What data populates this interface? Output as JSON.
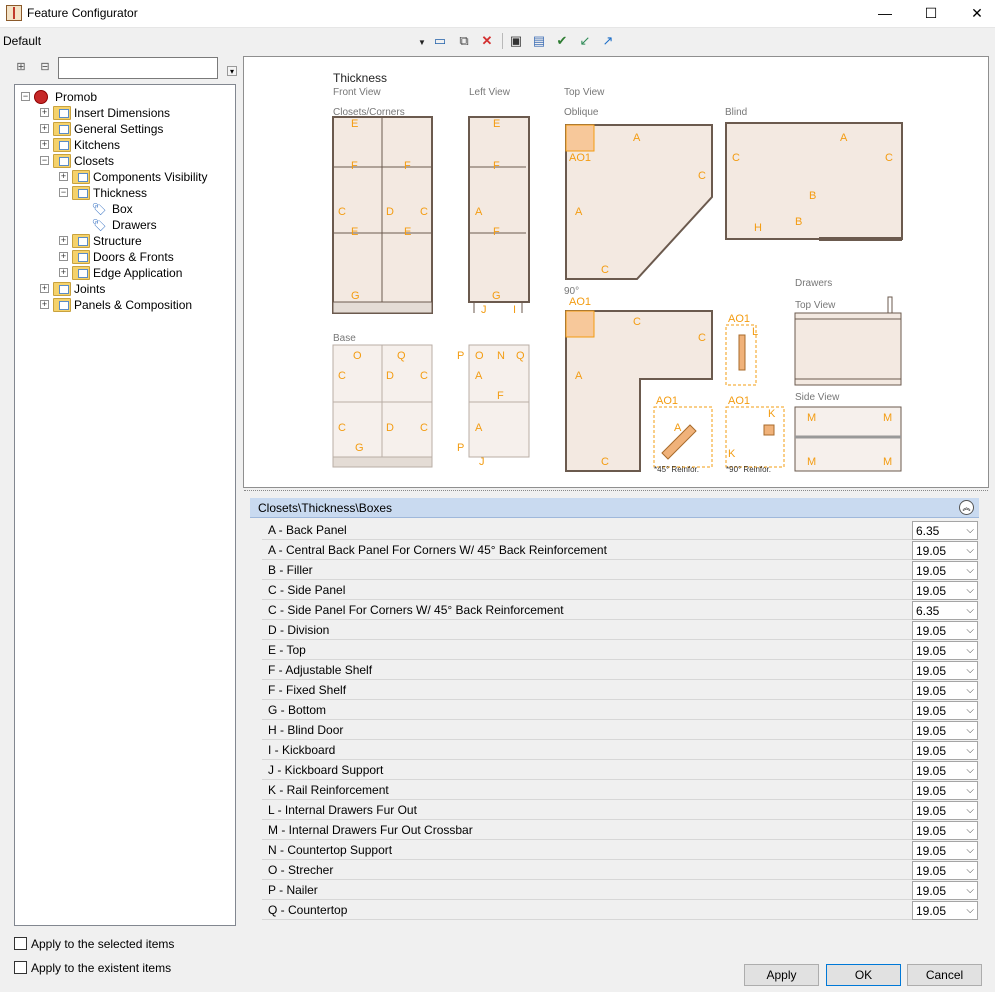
{
  "window": {
    "title": "Feature Configurator",
    "minimize": "—",
    "maximize": "☐",
    "close": "✕"
  },
  "toolbar": {
    "preset": "Default"
  },
  "tree": {
    "search_value": "",
    "items": [
      {
        "label": "Promob",
        "level": 0,
        "expander": "−",
        "icon": "globe"
      },
      {
        "label": "Insert Dimensions",
        "level": 1,
        "expander": "+",
        "icon": "folder"
      },
      {
        "label": "General Settings",
        "level": 1,
        "expander": "+",
        "icon": "folder"
      },
      {
        "label": "Kitchens",
        "level": 1,
        "expander": "+",
        "icon": "folder"
      },
      {
        "label": "Closets",
        "level": 1,
        "expander": "−",
        "icon": "folder"
      },
      {
        "label": "Components Visibility",
        "level": 2,
        "expander": "+",
        "icon": "folder"
      },
      {
        "label": "Thickness",
        "level": 2,
        "expander": "−",
        "icon": "folder"
      },
      {
        "label": "Box",
        "level": 3,
        "expander": "",
        "icon": "tag"
      },
      {
        "label": "Drawers",
        "level": 3,
        "expander": "",
        "icon": "tag"
      },
      {
        "label": "Structure",
        "level": 2,
        "expander": "+",
        "icon": "folder"
      },
      {
        "label": "Doors & Fronts",
        "level": 2,
        "expander": "+",
        "icon": "folder"
      },
      {
        "label": "Edge Application",
        "level": 2,
        "expander": "+",
        "icon": "folder"
      },
      {
        "label": "Joints",
        "level": 1,
        "expander": "+",
        "icon": "folder"
      },
      {
        "label": "Panels & Composition",
        "level": 1,
        "expander": "+",
        "icon": "folder"
      }
    ]
  },
  "preview": {
    "title": "Thickness",
    "front_view": "Front View",
    "left_view": "Left View",
    "top_view": "Top View",
    "closets_corners": "Closets/Corners",
    "oblique": "Oblique",
    "blind": "Blind",
    "base": "Base",
    "deg90": "90°",
    "drawers": "Drawers",
    "drawers_top": "Top View",
    "drawers_side": "Side View",
    "ao1": "AO1",
    "reinf45": "*45° Reinfor.",
    "reinf90": "*90° Reinfor."
  },
  "group": {
    "title": "Closets\\Thickness\\Boxes",
    "collapse_glyph": "︽"
  },
  "properties": [
    {
      "name": "A - Back Panel",
      "value": "6.35"
    },
    {
      "name": "A - Central Back Panel For Corners W/ 45° Back Reinforcement",
      "value": "19.05"
    },
    {
      "name": "B - Filler",
      "value": "19.05"
    },
    {
      "name": "C - Side Panel",
      "value": "19.05"
    },
    {
      "name": "C - Side Panel For Corners W/ 45° Back Reinforcement",
      "value": "6.35"
    },
    {
      "name": "D - Division",
      "value": "19.05"
    },
    {
      "name": "E - Top",
      "value": "19.05"
    },
    {
      "name": "F - Adjustable Shelf",
      "value": "19.05"
    },
    {
      "name": "F - Fixed Shelf",
      "value": "19.05"
    },
    {
      "name": "G - Bottom",
      "value": "19.05"
    },
    {
      "name": "H - Blind Door",
      "value": "19.05"
    },
    {
      "name": "I - Kickboard",
      "value": "19.05"
    },
    {
      "name": "J - Kickboard Support",
      "value": "19.05"
    },
    {
      "name": "K -  Rail Reinforcement",
      "value": "19.05"
    },
    {
      "name": "L - Internal Drawers Fur Out",
      "value": "19.05"
    },
    {
      "name": "M - Internal Drawers Fur Out Crossbar",
      "value": "19.05"
    },
    {
      "name": "N - Countertop Support",
      "value": "19.05"
    },
    {
      "name": "O - Strecher",
      "value": "19.05"
    },
    {
      "name": "P - Nailer",
      "value": "19.05"
    },
    {
      "name": "Q - Countertop",
      "value": "19.05"
    }
  ],
  "options": {
    "apply_selected": "Apply to the selected items",
    "apply_existent": "Apply to the existent items"
  },
  "buttons": {
    "apply": "Apply",
    "ok": "OK",
    "cancel": "Cancel"
  },
  "colors": {
    "accent": "#f39c12",
    "header_blue": "#c9daf0",
    "panel_fill": "#f3e9e1",
    "panel_edge": "#6b5a4e"
  }
}
